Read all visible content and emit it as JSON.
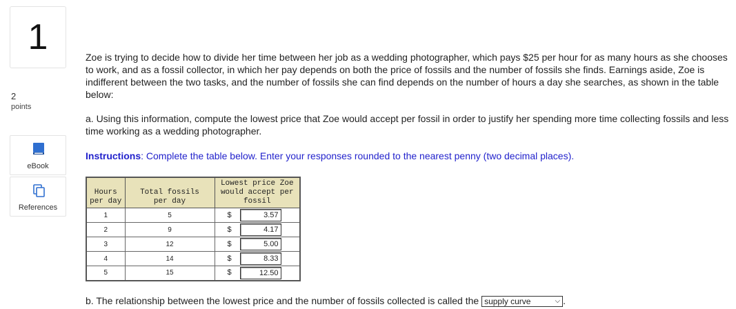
{
  "question": {
    "number": "1",
    "points_value": "2",
    "points_label": "points"
  },
  "sidebar": {
    "ebook_label": "eBook",
    "references_label": "References"
  },
  "content": {
    "intro": "Zoe is trying to decide how to divide her time between her job as a wedding photographer, which pays $25 per hour for as many hours as she chooses to work, and as a fossil collector, in which her pay depends on both the price of fossils and the number of fossils she finds. Earnings aside, Zoe is indifferent between the two tasks, and the number of fossils she can find depends on the number of hours a day she searches, as shown in the table below:",
    "part_a": "a. Using this information, compute the lowest price that Zoe would accept per fossil in order to justify her spending more time collecting fossils and less time working as a wedding photographer.",
    "instructions_label": "Instructions",
    "instructions_text": ": Complete the table below. Enter your responses rounded to the nearest penny (two decimal places).",
    "part_b_prefix": "b. The relationship between the lowest price and the number of fossils collected is called the",
    "part_b_suffix": "."
  },
  "table": {
    "headers": {
      "hours_line1": "Hours",
      "hours_line2": "per day",
      "fossils_line1": "Total fossils",
      "fossils_line2": "per day",
      "price_line1": "Lowest price Zoe",
      "price_line2": "would accept per",
      "price_line3": "fossil"
    },
    "currency": "$",
    "rows": [
      {
        "hours": "1",
        "fossils": "5",
        "price": "3.57"
      },
      {
        "hours": "2",
        "fossils": "9",
        "price": "4.17"
      },
      {
        "hours": "3",
        "fossils": "12",
        "price": "5.00"
      },
      {
        "hours": "4",
        "fossils": "14",
        "price": "8.33"
      },
      {
        "hours": "5",
        "fossils": "15",
        "price": "12.50"
      }
    ]
  },
  "dropdown": {
    "selected": "supply curve",
    "icon": "chevron-down-icon"
  },
  "colors": {
    "instructions": "#2222cc",
    "table_header_bg": "#e8e2ba",
    "ebook_icon": "#2f6fd0"
  }
}
